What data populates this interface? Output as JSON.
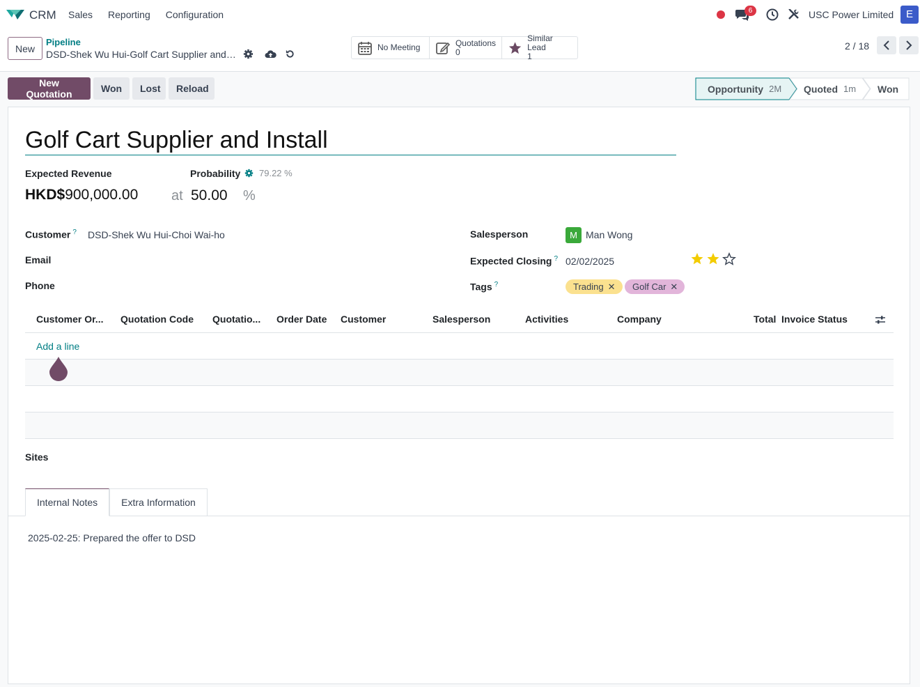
{
  "navbar": {
    "app_name": "CRM",
    "menu": [
      "Sales",
      "Reporting",
      "Configuration"
    ],
    "chat_badge": "6",
    "company": "USC Power Limited",
    "user_initial": "E"
  },
  "control": {
    "new_label": "New",
    "breadcrumb_parent": "Pipeline",
    "breadcrumb_current": "DSD-Shek Wu Hui-Golf Cart Supplier and Install",
    "smart_buttons": {
      "meeting": "No Meeting",
      "quotations_label": "Quotations",
      "quotations_count": "0",
      "similar_label": "Similar Lead",
      "similar_count": "1"
    },
    "pager": "2 / 18"
  },
  "statusbar": {
    "new_quotation": "New Quotation",
    "won": "Won",
    "lost": "Lost",
    "reload": "Reload",
    "stages": [
      {
        "name": "Opportunity",
        "time": "2M",
        "active": true
      },
      {
        "name": "Quoted",
        "time": "1m",
        "active": false
      },
      {
        "name": "Won",
        "time": "",
        "active": false
      }
    ]
  },
  "form": {
    "title": "Golf Cart Supplier and Install",
    "expected_revenue_label": "Expected Revenue",
    "probability_label": "Probability",
    "auto_probability": "79.22 %",
    "currency": "HKD$",
    "revenue_amount": "900,000.00",
    "at_label": "at",
    "probability_value": "50.00",
    "percent_sign": "%",
    "customer_label": "Customer",
    "customer_value": "DSD-Shek Wu Hui-Choi Wai-ho",
    "email_label": "Email",
    "phone_label": "Phone",
    "salesperson_label": "Salesperson",
    "salesperson_initial": "M",
    "salesperson_value": "Man Wong",
    "expected_closing_label": "Expected Closing",
    "expected_closing_value": "02/02/2025",
    "priority_stars": 2,
    "tags_label": "Tags",
    "tags": [
      "Trading",
      "Golf Car"
    ],
    "help_mark": "?"
  },
  "table": {
    "columns": [
      "Customer Or...",
      "Quotation Code",
      "Quotatio...",
      "Order Date",
      "Customer",
      "Salesperson",
      "Activities",
      "Company",
      "Total",
      "Invoice Status"
    ],
    "add_line": "Add a line"
  },
  "sites_label": "Sites",
  "tabs": [
    "Internal Notes",
    "Extra Information"
  ],
  "internal_note": "2025-02-25: Prepared the offer to DSD",
  "colors": {
    "primary": "#714b67",
    "teal": "#017e84",
    "tag_trading": "#fbe18f",
    "tag_golf": "#e2b5da"
  }
}
